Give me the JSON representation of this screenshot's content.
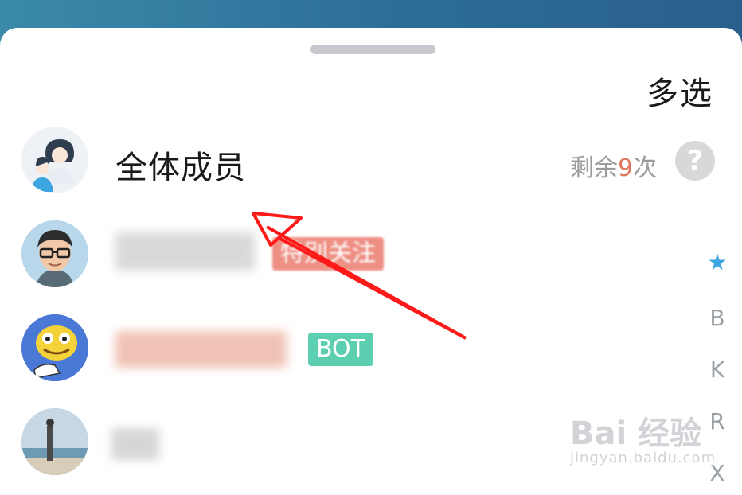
{
  "sheet": {
    "multi_select_label": "多选"
  },
  "rows": [
    {
      "name": "全体成员",
      "quota_prefix": "剩余",
      "quota_count": "9",
      "quota_suffix": "次",
      "help_label": "?"
    },
    {
      "tag": "特别关注"
    },
    {
      "tag": "BOT"
    },
    {}
  ],
  "index_bar": [
    "★",
    "B",
    "K",
    "R",
    "X"
  ],
  "watermark": {
    "brand": "Bai 经验",
    "url": "jingyan.baidu.com"
  },
  "colors": {
    "header": "#2c6d97",
    "special_tag_bg": "#ee8f84",
    "bot_tag_bg": "#5ccfb0",
    "quota_number": "#e07a5f",
    "index_star": "#3da5e0",
    "arrow": "#ff0000"
  }
}
